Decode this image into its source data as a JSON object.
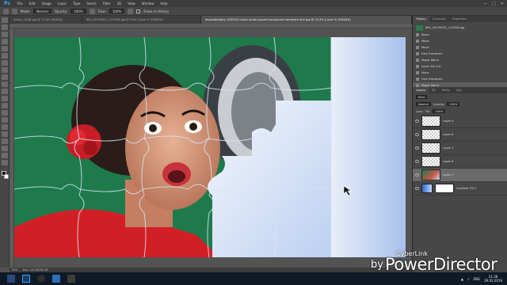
{
  "menubar": {
    "logo": "Ps",
    "items": [
      "File",
      "Edit",
      "Image",
      "Layer",
      "Type",
      "Select",
      "Filter",
      "3D",
      "View",
      "Window",
      "Help"
    ],
    "window_controls": [
      "—",
      "□",
      "✕"
    ]
  },
  "options": {
    "mode_label": "Mode:",
    "mode_value": "Normal",
    "opacity_label": "Opacity:",
    "opacity_value": "100%",
    "flow_label": "Flow:",
    "flow_value": "100%",
    "erase_label": "Erase to History"
  },
  "tabs": [
    "Album_0238.jpg @ 15,6% (RGB/8)",
    "IMG_20190321_113916.jpg @ 50% (Layer 9, RGB/8#)",
    "depositphotos_1055451 stock photo puzzle background template 6x4.jpg @ 33,3% (Layer 8, RGB/8#)"
  ],
  "status": {
    "zoom": "50%",
    "doc": "Doc: 14,0M/26,0M"
  },
  "history_panel": {
    "tabs": [
      "History",
      "Channels",
      "Properties"
    ],
    "snapshot": "IMG_20190321_113916.jpg",
    "items": [
      "Move",
      "Move",
      "Move",
      "Free Transform",
      "Magic Wand",
      "Layer Via Cut",
      "Move",
      "Free Transform",
      "Magic Wand"
    ]
  },
  "layers_panel": {
    "tabs": [
      "Layers",
      "3D",
      "Paths",
      "Info"
    ],
    "kind_label": "Kind",
    "blend": "Normal",
    "opacity_label": "Opacity:",
    "opacity_value": "100%",
    "lock_label": "Lock:",
    "fill_label": "Fill:",
    "fill_value": "100%",
    "layers": [
      "Layer 9",
      "Layer 8",
      "Layer 7",
      "Layer 6",
      "Layer 1"
    ],
    "gradient_layer": "Gradient Fill 1"
  },
  "taskbar": {
    "lang": "ENG",
    "time": "21:38",
    "date": "29.03.2019"
  },
  "watermark": {
    "top": "CyberLink",
    "by": "by",
    "brand": "PowerDirector"
  },
  "colors": {
    "green_bg": "#1e7a4b",
    "right_bg": "#b9cdf2",
    "accent": "#31a8ff"
  }
}
